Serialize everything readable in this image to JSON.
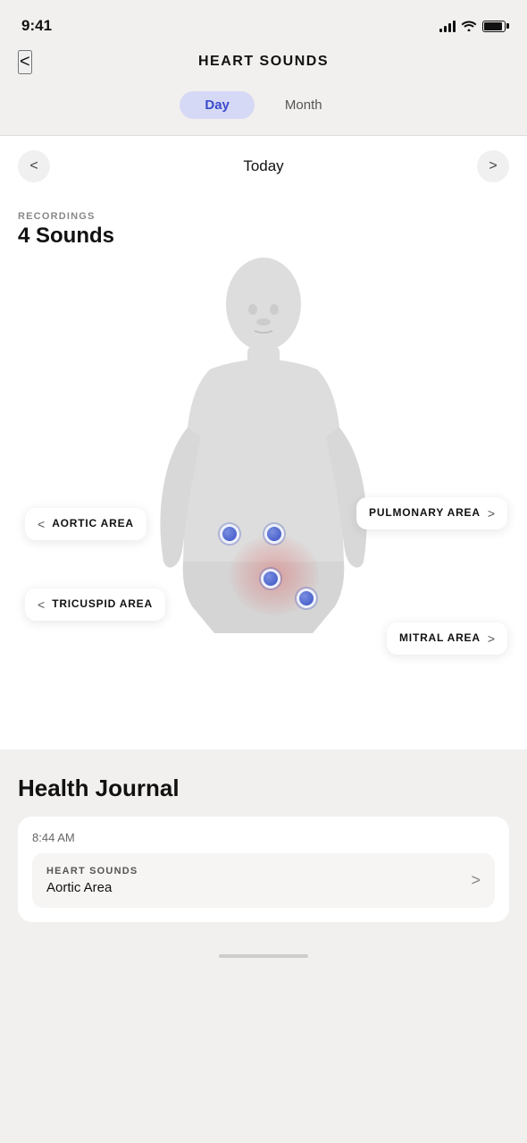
{
  "statusBar": {
    "time": "9:41"
  },
  "header": {
    "backLabel": "<",
    "title": "HEART SOUNDS"
  },
  "toggle": {
    "dayLabel": "Day",
    "monthLabel": "Month",
    "activeTab": "Day"
  },
  "dateNav": {
    "prevLabel": "<",
    "nextLabel": ">",
    "current": "Today"
  },
  "recordings": {
    "label": "RECORDINGS",
    "count": "4 Sounds"
  },
  "areas": {
    "aortic": {
      "label": "AORTIC AREA",
      "chevron": "<"
    },
    "pulmonary": {
      "label": "PULMONARY AREA",
      "chevron": ">"
    },
    "tricuspid": {
      "label": "TRICUSPID AREA",
      "chevron": "<"
    },
    "mitral": {
      "label": "MITRAL AREA",
      "chevron": ">"
    }
  },
  "healthJournal": {
    "title": "Health Journal",
    "time": "8:44 AM",
    "entryTitle": "HEART SOUNDS",
    "entrySubtitle": "Aortic Area",
    "entryChevron": ">"
  }
}
